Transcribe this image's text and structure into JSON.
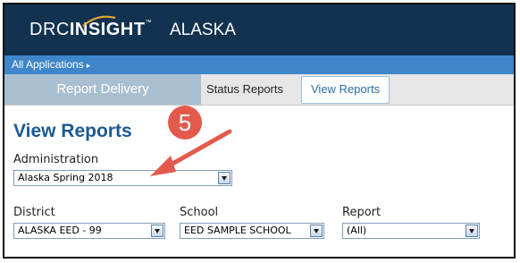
{
  "header": {
    "logo_drc": "DRC",
    "logo_insight": "INSIGHT",
    "logo_tm": "™",
    "state": "ALASKA"
  },
  "app_bar": {
    "all_applications": "All Applications",
    "caret": "▸"
  },
  "tabs": {
    "main": "Report Delivery",
    "status_reports": "Status Reports",
    "view_reports": "View Reports"
  },
  "page_title": "View Reports",
  "annotation": {
    "step_number": "5",
    "color": "#e35a4c"
  },
  "filters": {
    "administration": {
      "label": "Administration",
      "value": "Alaska Spring 2018"
    },
    "district": {
      "label": "District",
      "value": "ALASKA EED - 99"
    },
    "school": {
      "label": "School",
      "value": "EED SAMPLE SCHOOL"
    },
    "report": {
      "label": "Report",
      "value": "(All)"
    }
  },
  "colors": {
    "header_bg": "#12324f",
    "app_bar_bg": "#3e86c9",
    "accent": "#1b5a93"
  }
}
